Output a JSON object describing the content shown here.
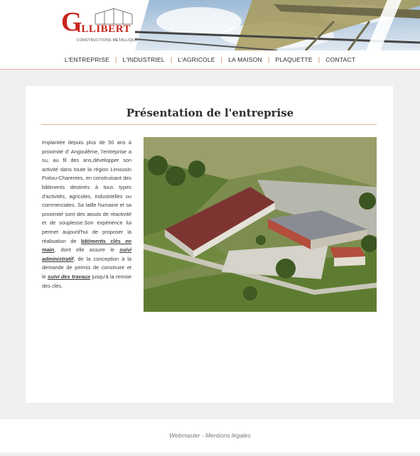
{
  "logo": {
    "initial": "G",
    "name": "ILLIBERT",
    "tagline": "CONSTRUCTIONS MÉTALLIQUES"
  },
  "nav": [
    {
      "label": "L'ENTREPRISE"
    },
    {
      "label": "L'INDUSTRIEL"
    },
    {
      "label": "L'AGRICOLE"
    },
    {
      "label": "LA MAISON"
    },
    {
      "label": "PLAQUETTE"
    },
    {
      "label": "CONTACT"
    }
  ],
  "page": {
    "title": "Présentation de l'entreprise",
    "text_1": "Implantée depuis plus de 50 ans à proximité d' Angoulême, l'entreprise a su, au fil des ans,développer son activité dans toute la région Limousin Poitou-Charentes, en construisant des bâtiments destinés à tous types d'activités, agricoles, industrielles ou commerciales. Sa taille humaine et sa proximité sont des atouts de réactivité et de souplesse.Son expérience lui permet aujourd'hui de proposer la réalisation de ",
    "link_1": "bâtiments clés en main",
    "text_2": ", dont elle assure le ",
    "link_2": "suivi administratif",
    "text_3": ", de la conception à la demande de permis de construire et le ",
    "link_3": "suivi des travaux",
    "text_4": " jusqu'à la remise des clés."
  },
  "footer": {
    "webmaster": "Webmaster",
    "separator": " - ",
    "legal": "Mentions légales"
  },
  "colors": {
    "accent": "#d27a5a",
    "logo_red": "#c8241c",
    "background": "#efefef"
  }
}
